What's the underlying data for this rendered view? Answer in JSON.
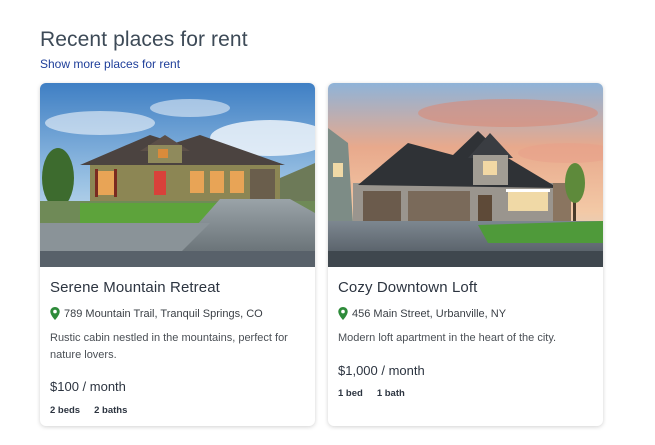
{
  "section": {
    "title": "Recent places for rent",
    "show_more": "Show more places for rent"
  },
  "listings": [
    {
      "title": "Serene Mountain Retreat",
      "location": "789 Mountain Trail, Tranquil Springs, CO",
      "description": "Rustic cabin nestled in the mountains, perfect for nature lovers.",
      "price": "$100 / month",
      "beds": "2 beds",
      "baths": "2 baths"
    },
    {
      "title": "Cozy Downtown Loft",
      "location": "456 Main Street, Urbanville, NY",
      "description": "Modern loft apartment in the heart of the city.",
      "price": "$1,000 / month",
      "beds": "1 bed",
      "baths": "1 bath"
    }
  ],
  "icons": {
    "location": "map-pin-icon",
    "pin_color": "#2e8b3a"
  }
}
